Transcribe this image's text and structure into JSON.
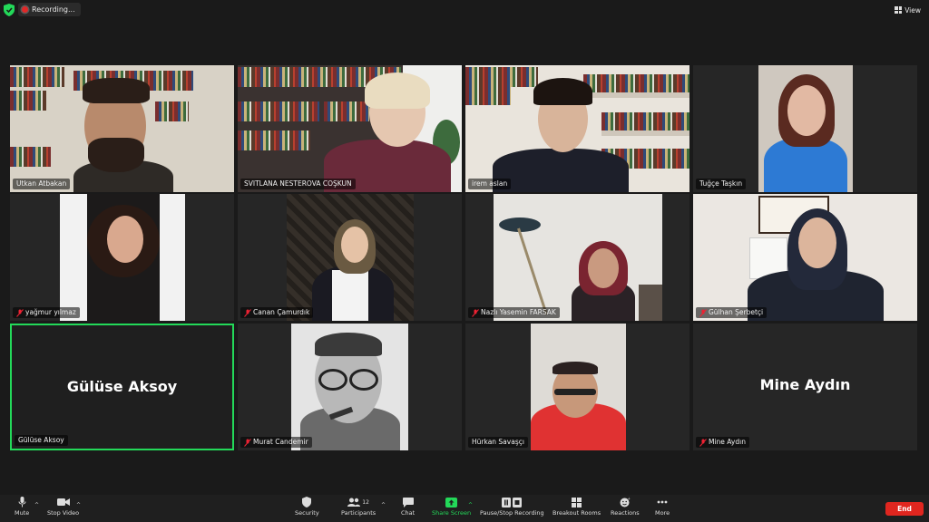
{
  "top_bar": {
    "recording_label": "Recording...",
    "view_label": "View"
  },
  "participants": [
    {
      "name": "Utkan Atbakan",
      "muted": false,
      "video": true
    },
    {
      "name": "SVITLANA NESTEROVA COŞKUN",
      "muted": false,
      "video": true
    },
    {
      "name": "irem aslan",
      "muted": false,
      "video": true
    },
    {
      "name": "Tuğçe Taşkın",
      "muted": false,
      "video": true
    },
    {
      "name": "yağmur yılmaz",
      "muted": true,
      "video": true
    },
    {
      "name": "Canan Çamurdık",
      "muted": true,
      "video": true
    },
    {
      "name": "Nazlı Yasemin FARSAK",
      "muted": true,
      "video": true
    },
    {
      "name": "Gülhan Şerbetçi",
      "muted": true,
      "video": true
    },
    {
      "name": "Gülüse Aksoy",
      "muted": false,
      "video": false,
      "display": "Gülüse Aksoy",
      "active_speaker": true
    },
    {
      "name": "Murat Candemir",
      "muted": true,
      "video": true
    },
    {
      "name": "Hürkan Savaşçı",
      "muted": false,
      "video": true
    },
    {
      "name": "Mine Aydın",
      "muted": true,
      "video": false,
      "display": "Mine Aydın"
    }
  ],
  "toolbar": {
    "mute": "Mute",
    "stop_video": "Stop Video",
    "security": "Security",
    "participants": "Participants",
    "participants_count": "12",
    "chat": "Chat",
    "share_screen": "Share Screen",
    "pause_recording": "Pause/Stop Recording",
    "breakout_rooms": "Breakout Rooms",
    "reactions": "Reactions",
    "more": "More",
    "end": "End"
  },
  "colors": {
    "active_speaker_border": "#23d959",
    "end_button": "#e0261f",
    "share_screen": "#23d959",
    "recording_dot": "#e02828"
  }
}
